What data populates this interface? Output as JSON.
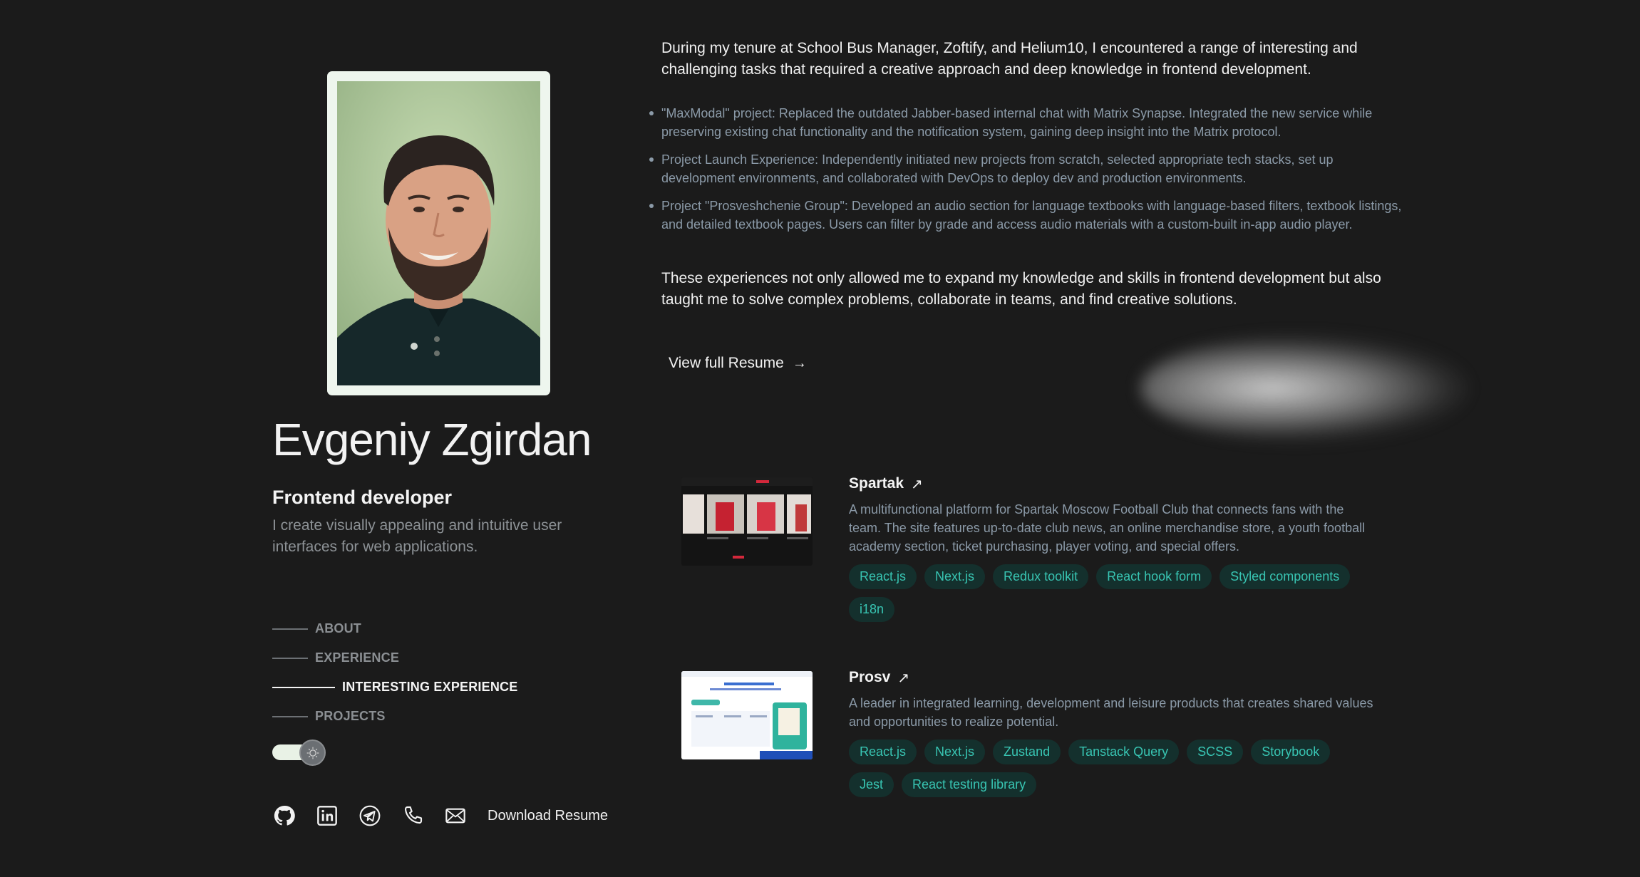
{
  "profile": {
    "name": "Evgeniy Zgirdan",
    "role": "Frontend developer",
    "tagline": "I create visually appealing and intuitive user interfaces for web applications."
  },
  "nav": {
    "items": [
      {
        "label": "ABOUT",
        "active": false
      },
      {
        "label": "EXPERIENCE",
        "active": false
      },
      {
        "label": "INTERESTING EXPERIENCE",
        "active": true
      },
      {
        "label": "PROJECTS",
        "active": false
      }
    ]
  },
  "theme_toggle": {
    "state": "light-off"
  },
  "socials": {
    "icons": [
      "github-icon",
      "linkedin-icon",
      "telegram-icon",
      "phone-icon",
      "mail-icon"
    ],
    "download_label": "Download Resume"
  },
  "experience": {
    "intro": "During my tenure at School Bus Manager, Zoftify, and Helium10, I encountered a range of interesting and challenging tasks that required a creative approach and deep knowledge in frontend development.",
    "bullets": [
      "\"MaxModal\" project: Replaced the outdated Jabber-based internal chat with Matrix Synapse. Integrated the new service while preserving existing chat functionality and the notification system, gaining deep insight into the Matrix protocol.",
      "Project Launch Experience: Independently initiated new projects from scratch, selected appropriate tech stacks, set up development environments, and collaborated with DevOps to deploy dev and production environments.",
      "Project \"Prosveshchenie Group\": Developed an audio section for language textbooks with language-based filters, textbook listings, and detailed textbook pages. Users can filter by grade and access audio materials with a custom-built in-app audio player."
    ],
    "outro": "These experiences not only allowed me to expand my knowledge and skills in frontend development but also taught me to solve complex problems, collaborate in teams, and find creative solutions.",
    "resume_link": "View full Resume",
    "resume_arrow": "→"
  },
  "projects": [
    {
      "title": "Spartak",
      "ext": "↗",
      "description": "A multifunctional platform for Spartak Moscow Football Club that connects fans with the team. The site features up-to-date club news, an online merchandise store, a youth football academy section, ticket purchasing, player voting, and special offers.",
      "tags": [
        "React.js",
        "Next.js",
        "Redux toolkit",
        "React hook form",
        "Styled components",
        "i18n"
      ]
    },
    {
      "title": "Prosv",
      "ext": "↗",
      "description": "A leader in integrated learning, development and leisure products that creates shared values and opportunities to realize potential.",
      "tags": [
        "React.js",
        "Next.js",
        "Zustand",
        "Tanstack Query",
        "SCSS",
        "Storybook",
        "Jest",
        "React testing library"
      ]
    }
  ],
  "colors": {
    "background": "#1b1b1b",
    "accent_teal": "#38c5b3",
    "tag_bg": "#14302d",
    "muted_text": "#8b9aa8"
  }
}
